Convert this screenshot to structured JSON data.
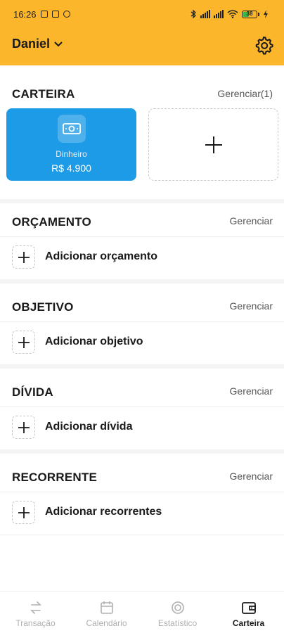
{
  "status_bar": {
    "time": "16:26",
    "battery": "38"
  },
  "header": {
    "user_name": "Daniel",
    "bg_color": "#fbb62b"
  },
  "wallet": {
    "title": "CARTEIRA",
    "manage_label": "Gerenciar(1)",
    "card": {
      "name": "Dinheiro",
      "amount": "R$ 4.900",
      "color": "#1e9be6"
    }
  },
  "budget": {
    "title": "ORÇAMENTO",
    "manage_label": "Gerenciar",
    "add_label": "Adicionar orçamento"
  },
  "goal": {
    "title": "OBJETIVO",
    "manage_label": "Gerenciar",
    "add_label": "Adicionar objetivo"
  },
  "debt": {
    "title": "DÍVIDA",
    "manage_label": "Gerenciar",
    "add_label": "Adicionar dívida"
  },
  "recurring": {
    "title": "RECORRENTE",
    "manage_label": "Gerenciar",
    "add_label": "Adicionar recorrentes"
  },
  "nav": {
    "items": [
      {
        "label": "Transação",
        "icon": "transfer-icon",
        "active": false
      },
      {
        "label": "Calendário",
        "icon": "calendar-icon",
        "active": false
      },
      {
        "label": "Estatístico",
        "icon": "statistics-icon",
        "active": false
      },
      {
        "label": "Carteira",
        "icon": "wallet-icon",
        "active": true
      }
    ]
  }
}
